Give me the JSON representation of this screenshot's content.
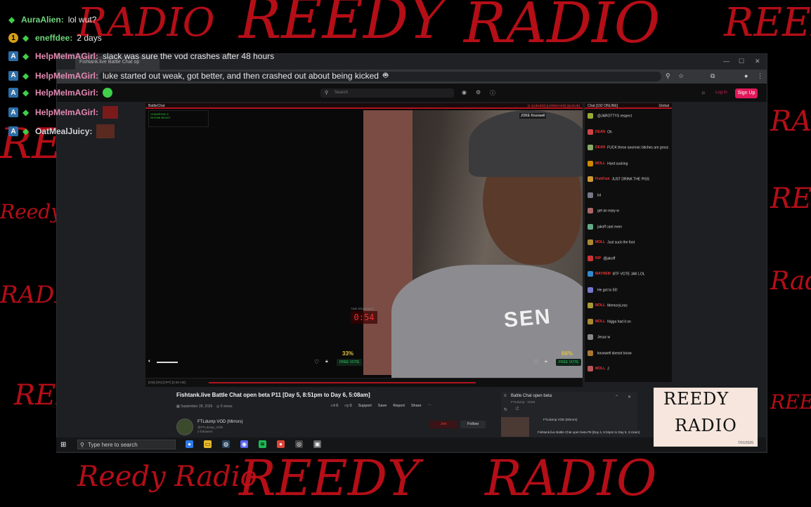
{
  "background": {
    "watermark_texts": [
      "RADIO",
      "REEDY",
      "RADIO",
      "REEDY",
      "REE",
      "Reedy",
      "RADIO",
      "RADIO",
      "REEDY",
      "Rad",
      "REEDY",
      "REEDY",
      "Reedy Radio",
      "REEDY",
      "RADIO"
    ],
    "accent_color": "#c8101a"
  },
  "overlay_chat": [
    {
      "badge": "gem",
      "name": "AuraAlien",
      "message": "lol wut?"
    },
    {
      "badge": "1",
      "name": "eneffdee",
      "message": "2 days"
    },
    {
      "badge": "A",
      "name": "HelpMeImAGirl",
      "message": "slack was sure the vod crashes after 48 hours"
    },
    {
      "badge": "A",
      "name": "HelpMeImAGirl",
      "message": "luke started out weak, got better, and then crashed out about being kicked"
    },
    {
      "badge": "A",
      "name": "HelpMeImAGirl",
      "message": ""
    },
    {
      "badge": "A",
      "name": "HelpMeImAGirl",
      "message": ""
    },
    {
      "badge": "A",
      "name": "OatMealJuicy",
      "message": ""
    }
  ],
  "browser": {
    "tab_title": "Fishtank.live Battle Chat op",
    "search_placeholder": "Search",
    "login_label": "Log In",
    "signup_label": "Sign Up"
  },
  "player": {
    "header_left": "BattleChat",
    "header_right": "[1 QUEUED] [LDRBOARD] [QUEUE]",
    "status_lines": [
      "CHAMPION ⊙",
      "RHYME BEAST"
    ],
    "tag_top": "JOKE Knoxwell",
    "timer_label": "TIME REMAINING",
    "timer": "0:54",
    "percent_left": "33%",
    "percent_right": "66%",
    "free_vote": "FREE VOTE",
    "shirt_text": "SEN",
    "bottom_bar": "[ON]  [ON]  [OFF]  [3:38 AM]"
  },
  "chat_panel": {
    "header": "Chat [192 ONLINE]",
    "header_right": "Global",
    "messages": [
      {
        "name": "",
        "text": "@JAROTTYS respect"
      },
      {
        "name": "DEAN",
        "text": "Oh"
      },
      {
        "name": "DEAN",
        "text": "FUCK these anorexic bitches are gross"
      },
      {
        "name": "MOLL",
        "text": "Hard sucking"
      },
      {
        "name": "FishFish",
        "text": "JUST DRINK THE PISS"
      },
      {
        "name": "",
        "text": "lol"
      },
      {
        "name": "",
        "text": "get an easy w"
      },
      {
        "name": "",
        "text": "jakoff cant even"
      },
      {
        "name": "MOLL",
        "text": "Just suck the foot"
      },
      {
        "name": "RIP",
        "text": "@jakoff"
      },
      {
        "name": "MAYHEM",
        "text": "BTF VOTE JAK LOL"
      },
      {
        "name": "",
        "text": "He got to 55!"
      },
      {
        "name": "MOLL",
        "text": "MemoryLess"
      },
      {
        "name": "MOLL",
        "text": "Nigga had it on"
      },
      {
        "name": "",
        "text": "Jesus w"
      },
      {
        "name": "",
        "text": "knoxwell doesnt know"
      },
      {
        "name": "MOLL",
        "text": "J"
      }
    ]
  },
  "video_info": {
    "title": "Fishtank.live Battle Chat open beta P11 [Day 5, 8:51pm to Day 6, 5:08am]",
    "date": "September 28, 2026",
    "views": "5 views",
    "likes": "0",
    "dislikes": "0",
    "actions": [
      "Support",
      "Save",
      "Report",
      "Share"
    ],
    "channel_name": "FTLdump VOD (Mirrors)",
    "channel_handle": "@FTLdump_VOD",
    "followers": "3 followers",
    "join_label": "Join",
    "follow_label": "Follow"
  },
  "miniplayer": {
    "title": "Battle Chat open beta",
    "subtitle": "FTLdump - 11/59",
    "related": [
      {
        "title": "FTLdump VOD (Mirrors)"
      },
      {
        "title": "Fishtank.live Battle Chat open beta P8 [Day 4, 6:04pm to Day 5, 3:41am]"
      }
    ]
  },
  "taskbar": {
    "search_placeholder": "Type here to search"
  },
  "logo": {
    "line1": "REEDY",
    "line2": "RADIO",
    "date": "7/01/2026"
  }
}
